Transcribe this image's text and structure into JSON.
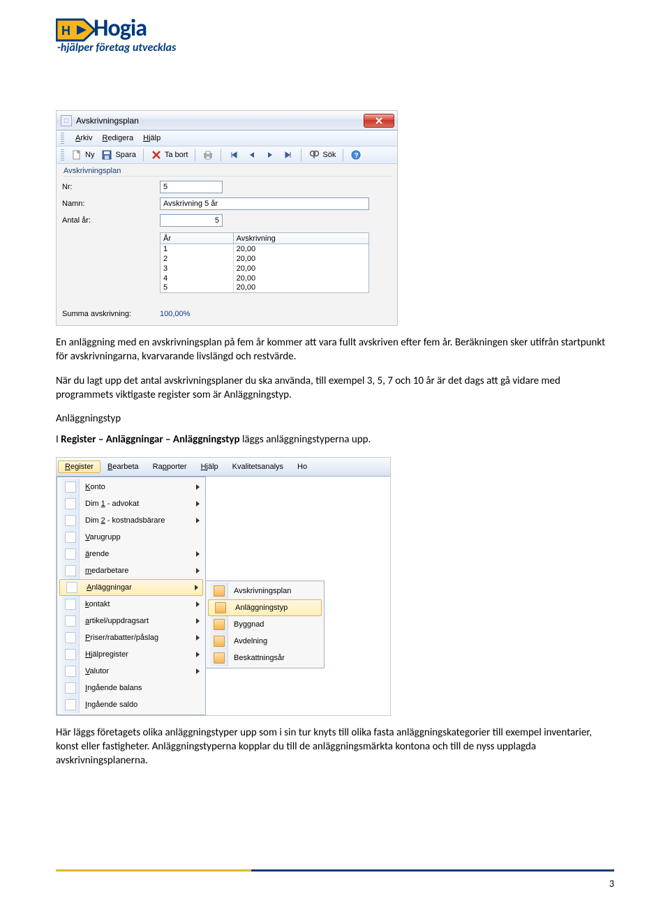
{
  "logo": {
    "name": "Hogia",
    "tagline": "-hjälper företag utvecklas"
  },
  "shot1": {
    "title": "Avskrivningsplan",
    "menus": {
      "arkiv": "Arkiv",
      "redigera": "Redigera",
      "hjalp": "Hjälp"
    },
    "toolbar": {
      "ny": "Ny",
      "spara": "Spara",
      "tabort": "Ta bort",
      "sok": "Sök"
    },
    "fieldset_label": "Avskrivningsplan",
    "labels": {
      "nr": "Nr:",
      "namn": "Namn:",
      "antal": "Antal år:"
    },
    "values": {
      "nr": "5",
      "namn": "Avskrivning 5 år",
      "antal": "5"
    },
    "grid": {
      "cols": {
        "ar": "År",
        "avskr": "Avskrivning"
      },
      "rows": [
        {
          "ar": "1",
          "avskr": "20,00"
        },
        {
          "ar": "2",
          "avskr": "20,00"
        },
        {
          "ar": "3",
          "avskr": "20,00"
        },
        {
          "ar": "4",
          "avskr": "20,00"
        },
        {
          "ar": "5",
          "avskr": "20,00"
        }
      ]
    },
    "sum_label": "Summa avskrivning:",
    "sum_value": "100,00%"
  },
  "para1": "En anläggning med en avskrivningsplan på fem år kommer att vara fullt avskriven efter fem år. Beräkningen sker utifrån startpunkt för avskrivningarna, kvarvarande livslängd och restvärde.",
  "para2": "När du lagt upp det antal avskrivningsplaner du ska använda, till exempel 3, 5, 7 och 10 år är det dags att gå vidare med programmets viktigaste register som är Anläggningstyp.",
  "heading3": "Anläggningstyp",
  "para3_pre": "I ",
  "para3_bold": "Register – Anläggningar – Anläggningstyp",
  "para3_post": " läggs anläggningstyperna upp.",
  "shot2": {
    "menubar": {
      "register": "Register",
      "bearbeta": "Bearbeta",
      "rapporter": "Rapporter",
      "hjalp": "Hjälp",
      "kvalitet": "Kvalitetsanalys",
      "ho": "Ho"
    },
    "dd1": [
      "Konto",
      "Dim 1 - advokat",
      "Dim 2 - kostnadsbärare",
      "Varugrupp",
      "ärende",
      "medarbetare",
      "Anläggningar",
      "kontakt",
      "artikel/uppdragsart",
      "Priser/rabatter/påslag",
      "Hjälpregister",
      "Valutor",
      "Ingående balans",
      "Ingående saldo"
    ],
    "dd1_selected": "Anläggningar",
    "dd1_arrows": [
      "Konto",
      "Dim 1 - advokat",
      "Dim 2 - kostnadsbärare",
      "ärende",
      "medarbetare",
      "Anläggningar",
      "kontakt",
      "artikel/uppdragsart",
      "Priser/rabatter/påslag",
      "Hjälpregister",
      "Valutor"
    ],
    "dd2": [
      "Avskrivningsplan",
      "Anläggningstyp",
      "Byggnad",
      "Avdelning",
      "Beskattningsår"
    ],
    "dd2_selected": "Anläggningstyp"
  },
  "para4": "Här läggs företagets olika anläggningstyper upp som i sin tur knyts till olika fasta anläggningskategorier till exempel inventarier, konst eller fastigheter. Anläggningstyperna kopplar du till de anläggningsmärkta kontona och till de nyss upplagda avskrivningsplanerna.",
  "page_number": "3"
}
